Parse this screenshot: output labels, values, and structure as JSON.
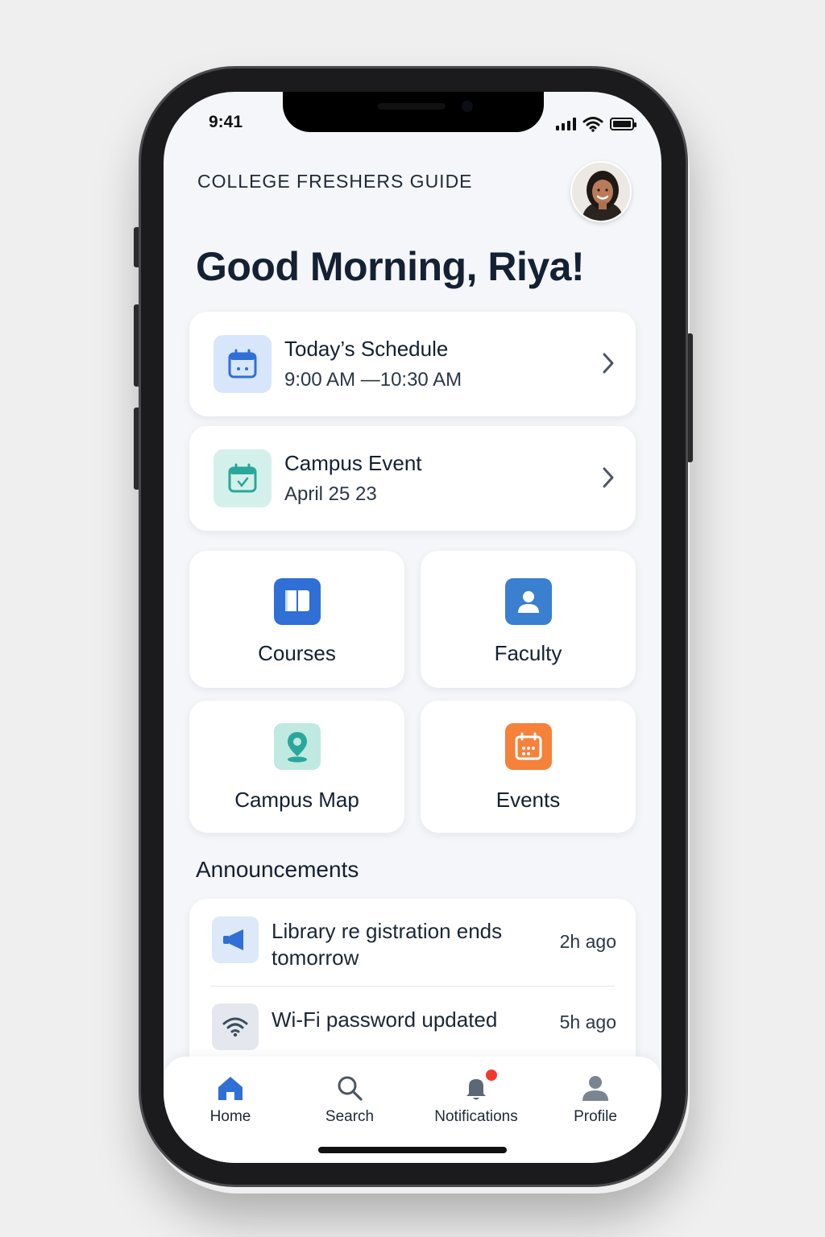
{
  "status_bar": {
    "time": "9:41"
  },
  "header": {
    "app_title": "COLLEGE FRESHERS GUIDE",
    "greeting": "Good Morning, Riya!"
  },
  "cards": {
    "schedule": {
      "title": "Today’s Schedule",
      "subtitle": "9:00 AM —10:30 AM"
    },
    "event": {
      "title": "Campus Event",
      "subtitle": "April 25 23"
    }
  },
  "tiles": {
    "courses": "Courses",
    "faculty": "Faculty",
    "campus_map": "Campus Map",
    "events": "Events"
  },
  "announcements": {
    "title": "Announcements",
    "items": [
      {
        "text_line1": "Library re gistration ends",
        "text_line2": "tomorrow",
        "time": "2h ago",
        "icon": "megaphone-icon"
      },
      {
        "text_line1": "Wi-Fi password updated",
        "text_line2": "",
        "time": "5h ago",
        "icon": "wifi-icon"
      }
    ]
  },
  "tabbar": {
    "home": "Home",
    "search": "Search",
    "notifications": "Notifications",
    "profile": "Profile"
  },
  "colors": {
    "primary_blue": "#2f6fd6",
    "teal": "#2aa79b",
    "orange": "#f5813a",
    "badge_red": "#ef3b2f"
  }
}
